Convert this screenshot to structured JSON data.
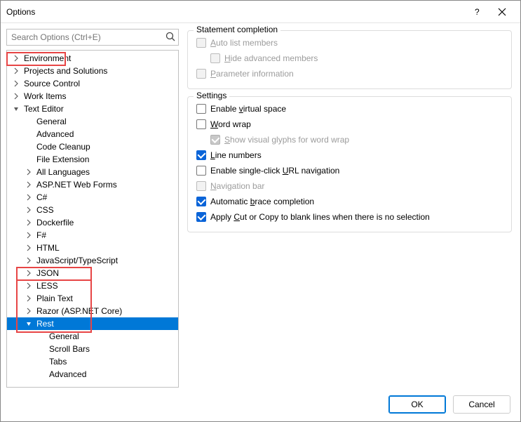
{
  "title": "Options",
  "search_placeholder": "Search Options (Ctrl+E)",
  "tree": {
    "text_editor": "Text Editor",
    "rest": "Rest"
  },
  "tree_rows": [
    {
      "indent": 1,
      "arrow": "right",
      "label": "Environment"
    },
    {
      "indent": 1,
      "arrow": "right",
      "label": "Projects and Solutions"
    },
    {
      "indent": 1,
      "arrow": "right",
      "label": "Source Control"
    },
    {
      "indent": 1,
      "arrow": "right",
      "label": "Work Items"
    },
    {
      "indent": 1,
      "arrow": "down",
      "label": "Text Editor",
      "key": "text_editor",
      "hl": true
    },
    {
      "indent": 2,
      "arrow": "",
      "label": "General"
    },
    {
      "indent": 2,
      "arrow": "",
      "label": "Advanced"
    },
    {
      "indent": 2,
      "arrow": "",
      "label": "Code Cleanup"
    },
    {
      "indent": 2,
      "arrow": "",
      "label": "File Extension"
    },
    {
      "indent": 2,
      "arrow": "right",
      "label": "All Languages"
    },
    {
      "indent": 2,
      "arrow": "right",
      "label": "ASP.NET Web Forms"
    },
    {
      "indent": 2,
      "arrow": "right",
      "label": "C#"
    },
    {
      "indent": 2,
      "arrow": "right",
      "label": "CSS"
    },
    {
      "indent": 2,
      "arrow": "right",
      "label": "Dockerfile"
    },
    {
      "indent": 2,
      "arrow": "right",
      "label": "F#"
    },
    {
      "indent": 2,
      "arrow": "right",
      "label": "HTML"
    },
    {
      "indent": 2,
      "arrow": "right",
      "label": "JavaScript/TypeScript"
    },
    {
      "indent": 2,
      "arrow": "right",
      "label": "JSON"
    },
    {
      "indent": 2,
      "arrow": "right",
      "label": "LESS"
    },
    {
      "indent": 2,
      "arrow": "right",
      "label": "Plain Text"
    },
    {
      "indent": 2,
      "arrow": "right",
      "label": "Razor (ASP.NET Core)"
    },
    {
      "indent": 2,
      "arrow": "down",
      "label": "Rest",
      "key": "rest",
      "selected": true,
      "hl": true
    },
    {
      "indent": 3,
      "arrow": "",
      "label": "General",
      "hl": true
    },
    {
      "indent": 3,
      "arrow": "",
      "label": "Scroll Bars",
      "hl": true
    },
    {
      "indent": 3,
      "arrow": "",
      "label": "Tabs",
      "hl": true
    },
    {
      "indent": 3,
      "arrow": "",
      "label": "Advanced",
      "hl": true
    }
  ],
  "sections": {
    "statement": "Statement completion",
    "settings": "Settings"
  },
  "options": {
    "auto_list": {
      "pre": "",
      "u": "A",
      "post": "uto list members"
    },
    "hide_adv": {
      "pre": "",
      "u": "H",
      "post": "ide advanced members"
    },
    "param_info": {
      "pre": "",
      "u": "P",
      "post": "arameter information"
    },
    "virtual_space": {
      "pre": "Enable ",
      "u": "v",
      "post": "irtual space"
    },
    "word_wrap": {
      "pre": "",
      "u": "W",
      "post": "ord wrap"
    },
    "visual_glyphs": {
      "pre": "",
      "u": "S",
      "post": "how visual glyphs for word wrap"
    },
    "line_numbers": {
      "pre": "",
      "u": "L",
      "post": "ine numbers"
    },
    "single_click": {
      "pre": "Enable single-click ",
      "u": "U",
      "post": "RL navigation"
    },
    "nav_bar": {
      "pre": "",
      "u": "N",
      "post": "avigation bar"
    },
    "brace": {
      "pre": "Automatic ",
      "u": "b",
      "post": "race completion"
    },
    "blank_lines": {
      "pre": "Apply ",
      "u": "C",
      "post": "ut or Copy to blank lines when there is no selection"
    }
  },
  "buttons": {
    "ok": "OK",
    "cancel": "Cancel"
  }
}
